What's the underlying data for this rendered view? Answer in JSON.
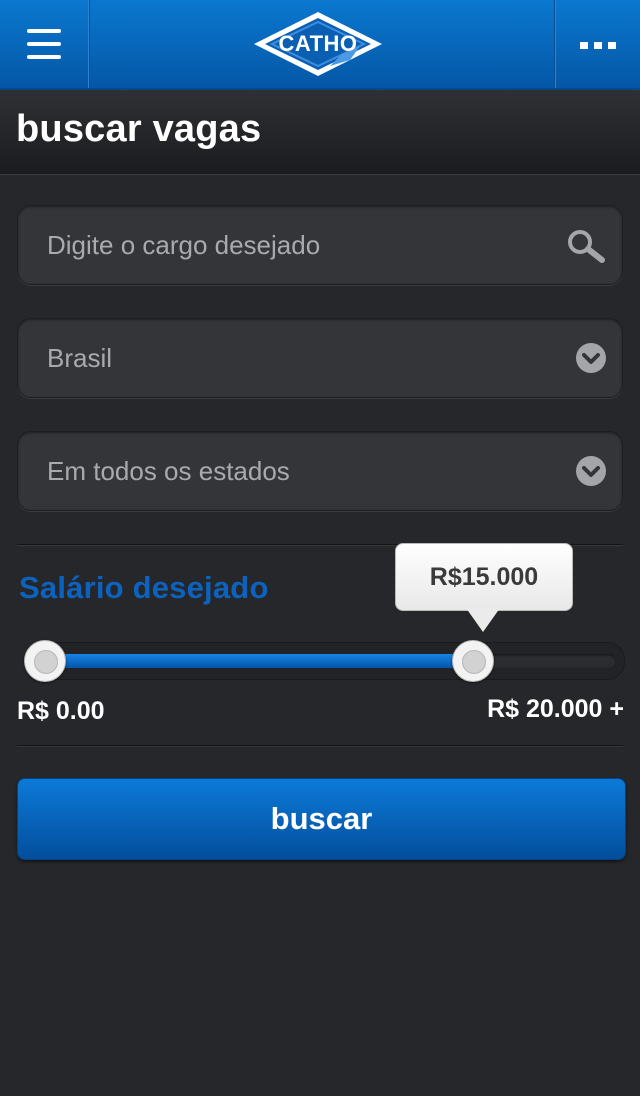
{
  "header": {
    "logo_text": "CATHO",
    "menu_icon": "hamburger-menu-icon",
    "more_icon": "more-options-icon",
    "brand_color": "#0a6bc4"
  },
  "page": {
    "title": "buscar vagas"
  },
  "form": {
    "job_input": {
      "placeholder": "Digite o cargo desejado",
      "value": "",
      "icon": "search-icon"
    },
    "country_select": {
      "selected": "Brasil",
      "icon": "chevron-down-icon"
    },
    "state_select": {
      "selected": "Em todos os estados",
      "icon": "chevron-down-icon"
    }
  },
  "salary": {
    "label": "Salário desejado",
    "tooltip": "R$15.000",
    "min_label": "R$ 0.00",
    "max_label": "R$ 20.000 +",
    "range_min": 0,
    "range_max": 20000,
    "selected_min": 0,
    "selected_max": 15000,
    "accent_color": "#0c63bf"
  },
  "actions": {
    "search_button": "buscar"
  }
}
